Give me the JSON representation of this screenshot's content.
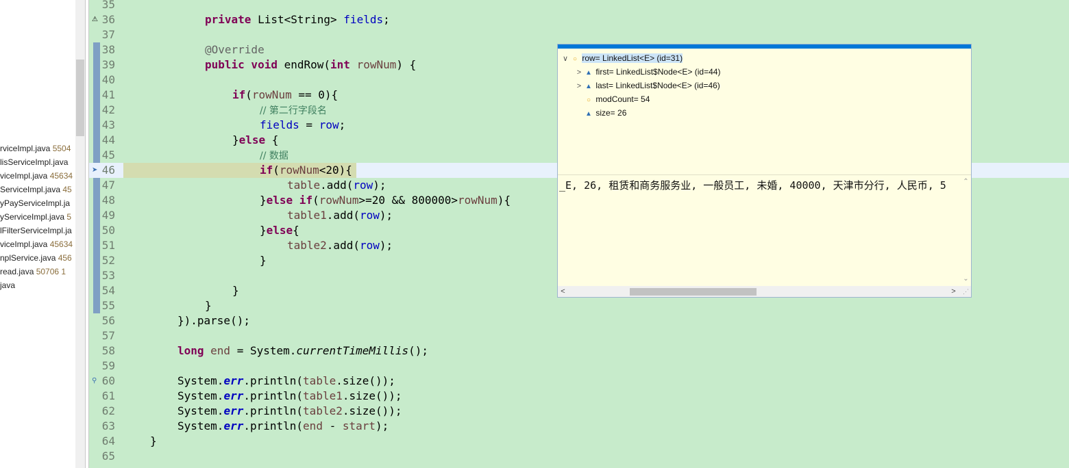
{
  "explorer": {
    "files": [
      {
        "name": "rviceImpl.java",
        "meta": " 5504"
      },
      {
        "name": "lisServiceImpl.java",
        "meta": ""
      },
      {
        "name": "viceImpl.java",
        "meta": " 45634"
      },
      {
        "name": "ServiceImpl.java",
        "meta": " 45"
      },
      {
        "name": "yPayServiceImpl.ja",
        "meta": ""
      },
      {
        "name": "yServiceImpl.java",
        "meta": " 5"
      },
      {
        "name": "lFilterServiceImpl.ja",
        "meta": ""
      },
      {
        "name": "viceImpl.java",
        "meta": " 45634"
      },
      {
        "name": "nplService.java",
        "meta": " 456"
      },
      {
        "name": "read.java",
        "meta": " 50706  1"
      },
      {
        "name": "java",
        "meta": ""
      }
    ]
  },
  "editor": {
    "lines": [
      {
        "n": "35"
      },
      {
        "n": "36"
      },
      {
        "n": "37"
      },
      {
        "n": "38"
      },
      {
        "n": "39"
      },
      {
        "n": "40"
      },
      {
        "n": "41"
      },
      {
        "n": "42"
      },
      {
        "n": "43"
      },
      {
        "n": "44"
      },
      {
        "n": "45"
      },
      {
        "n": "46"
      },
      {
        "n": "47"
      },
      {
        "n": "48"
      },
      {
        "n": "49"
      },
      {
        "n": "50"
      },
      {
        "n": "51"
      },
      {
        "n": "52"
      },
      {
        "n": "53"
      },
      {
        "n": "54"
      },
      {
        "n": "55"
      },
      {
        "n": "56"
      },
      {
        "n": "57"
      },
      {
        "n": "58"
      },
      {
        "n": "59"
      },
      {
        "n": "60"
      },
      {
        "n": "61"
      },
      {
        "n": "62"
      },
      {
        "n": "63"
      },
      {
        "n": "64"
      },
      {
        "n": "65"
      }
    ],
    "code": {
      "l36": {
        "kw": "private",
        "type": " List<String> ",
        "fld": "fields",
        "end": ";"
      },
      "l38": {
        "ann": "@Override"
      },
      "l39": {
        "kw1": "public",
        "kw2": " void",
        "m": " endRow(",
        "kw3": "int",
        "var": " rowNum",
        "end": ") {"
      },
      "l41": {
        "kw": "if",
        "a": "(",
        "var": "rowNum",
        "b": " == 0){"
      },
      "l42": {
        "cm": "// 第二行字段名"
      },
      "l43": {
        "fld": "fields",
        "a": " = ",
        "var": "row",
        "b": ";"
      },
      "l44": {
        "a": "}",
        "kw": "else",
        "b": " {"
      },
      "l45": {
        "cm": "// 数据"
      },
      "l46": {
        "kw": "if",
        "a": "(",
        "var": "rowNum",
        "b": "<20){"
      },
      "l47": {
        "var1": "table",
        "a": ".add(",
        "var2": "row",
        "b": ");"
      },
      "l48": {
        "a": "}",
        "kw1": "else",
        "kw2": " if",
        "b": "(",
        "var1": "rowNum",
        "c": ">=20 && 800000>",
        "var2": "rowNum",
        "d": "){"
      },
      "l49": {
        "var1": "table1",
        "a": ".add(",
        "var2": "row",
        "b": ");"
      },
      "l50": {
        "a": "}",
        "kw": "else",
        "b": "{"
      },
      "l51": {
        "var1": "table2",
        "a": ".add(",
        "var2": "row",
        "b": ");"
      },
      "l52": {
        "a": "}"
      },
      "l54": {
        "a": "}"
      },
      "l55": {
        "a": "}"
      },
      "l56": {
        "a": "}).parse();"
      },
      "l58": {
        "kw": "long",
        "var": " end",
        "a": " = System.",
        "it": "currentTimeMillis",
        "b": "();"
      },
      "l60": {
        "a": "System.",
        "st": "err",
        "b": ".println(",
        "var": "table",
        "c": ".size());"
      },
      "l61": {
        "a": "System.",
        "st": "err",
        "b": ".println(",
        "var": "table1",
        "c": ".size());"
      },
      "l62": {
        "a": "System.",
        "st": "err",
        "b": ".println(",
        "var": "table2",
        "c": ".size());"
      },
      "l63": {
        "a": "System.",
        "st": "err",
        "b": ".println(",
        "var1": "end",
        "c": " - ",
        "var2": "start",
        "d": ");"
      },
      "l64": {
        "a": "}"
      }
    }
  },
  "popup": {
    "nodes": [
      {
        "twisty": "∨",
        "label": "row= LinkedList<E>  (id=31)"
      },
      {
        "twisty": ">",
        "label": "first= LinkedList$Node<E>  (id=44)"
      },
      {
        "twisty": ">",
        "label": "last= LinkedList$Node<E>  (id=46)"
      },
      {
        "twisty": "",
        "label": "modCount= 54"
      },
      {
        "twisty": "",
        "label": "size= 26"
      }
    ],
    "detail_text": "_E, 26, 租赁和商务服务业, 一般员工, 未婚, 40000, 天津市分行, 人民币, 5"
  }
}
